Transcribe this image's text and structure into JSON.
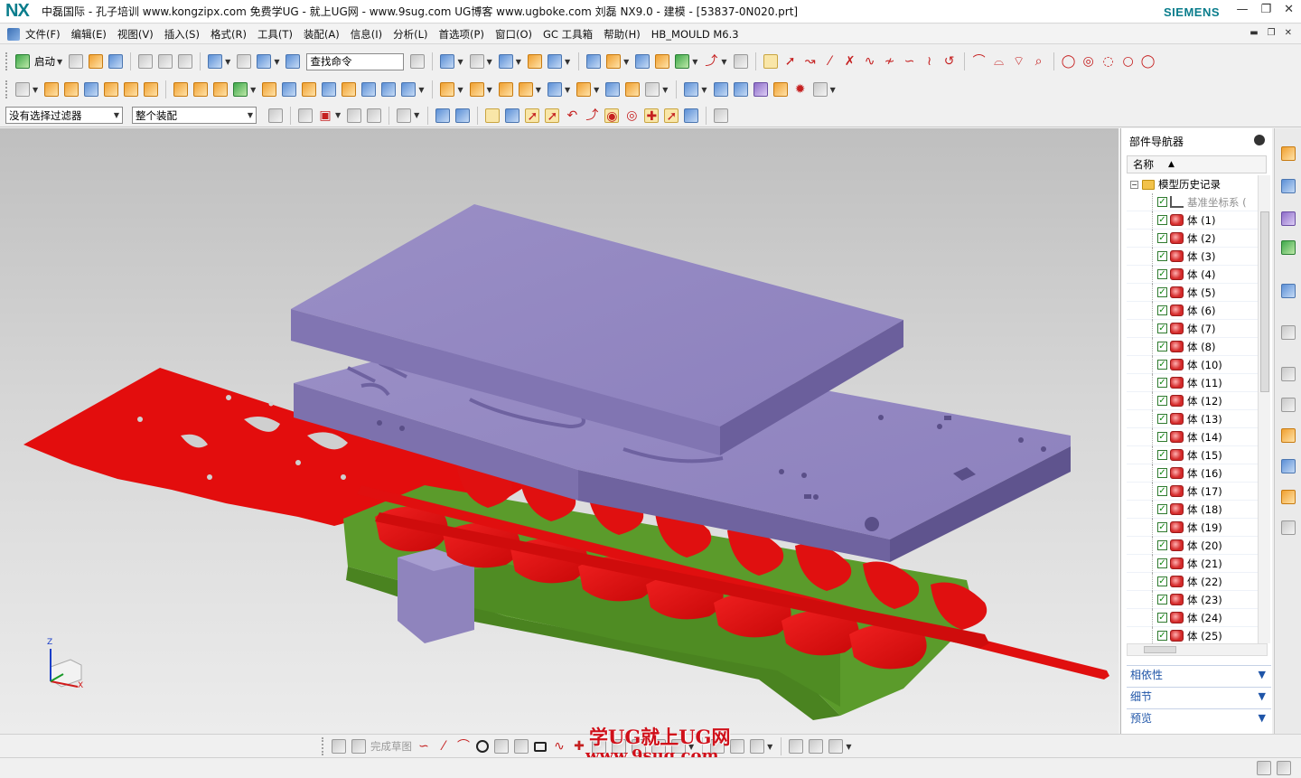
{
  "window": {
    "logo": "NX",
    "title": "中磊国际 - 孔子培训 www.kongzipx.com 免费学UG - 就上UG网 - www.9sug.com  UG博客 www.ugboke.com 刘磊  NX9.0 - 建模 - [53837-0N020.prt]",
    "brand": "SIEMENS"
  },
  "menu": {
    "items": [
      "文件(F)",
      "编辑(E)",
      "视图(V)",
      "插入(S)",
      "格式(R)",
      "工具(T)",
      "装配(A)",
      "信息(I)",
      "分析(L)",
      "首选项(P)",
      "窗口(O)",
      "GC 工具箱",
      "帮助(H)",
      "HB_MOULD M6.3"
    ]
  },
  "toolbar": {
    "start_label": "启动",
    "find_command": "查找命令"
  },
  "selection": {
    "filter": "没有选择过滤器",
    "scope": "整个装配"
  },
  "navigator": {
    "title": "部件导航器",
    "column_name": "名称",
    "root": "模型历史记录",
    "datum": "基准坐标系 (",
    "bodies": [
      "体 (1)",
      "体 (2)",
      "体 (3)",
      "体 (4)",
      "体 (5)",
      "体 (6)",
      "体 (7)",
      "体 (8)",
      "体 (10)",
      "体 (11)",
      "体 (12)",
      "体 (13)",
      "体 (14)",
      "体 (15)",
      "体 (16)",
      "体 (17)",
      "体 (18)",
      "体 (19)",
      "体 (20)",
      "体 (21)",
      "体 (22)",
      "体 (23)",
      "体 (24)",
      "体 (25)"
    ],
    "panels": [
      "相依性",
      "细节",
      "预览"
    ]
  },
  "triad": {
    "z": "Z",
    "y": "Y",
    "x": "X"
  },
  "sketch_toolbar": {
    "finish_sketch": "完成草图"
  },
  "watermark": {
    "line1": "学UG就上UG网",
    "line2": "www.9sug.com"
  },
  "colors": {
    "plate": "#9386c0",
    "strip": "#e00f0f",
    "die_base": "#5a9a2a",
    "accent": "#0a7d8c"
  }
}
